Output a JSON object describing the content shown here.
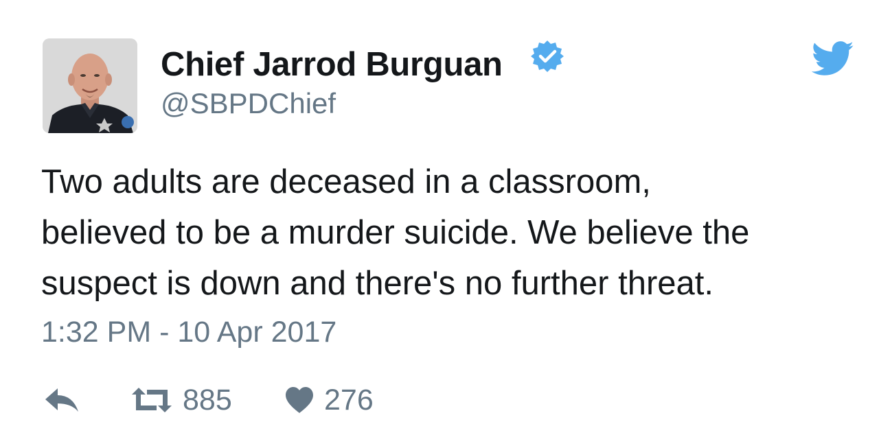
{
  "tweet": {
    "author": {
      "display_name": "Chief Jarrod Burguan",
      "handle": "@SBPDChief",
      "verified": true,
      "avatar_icon": "profile-photo"
    },
    "text_lines": [
      "Two adults are deceased in a classroom,",
      "believed to be a murder suicide. We believe the",
      "suspect is down and there's no further threat."
    ],
    "timestamp": "1:32 PM - 10 Apr 2017",
    "stats": {
      "retweets": "885",
      "likes": "276"
    }
  },
  "icons": {
    "logo": "twitter-bird-icon",
    "verified": "verified-badge-icon",
    "reply": "reply-icon",
    "retweet": "retweet-icon",
    "like": "heart-icon"
  },
  "colors": {
    "brand_blue": "#55acee",
    "text_primary": "#14171a",
    "text_secondary": "#657786",
    "icon_gray": "#657786"
  }
}
